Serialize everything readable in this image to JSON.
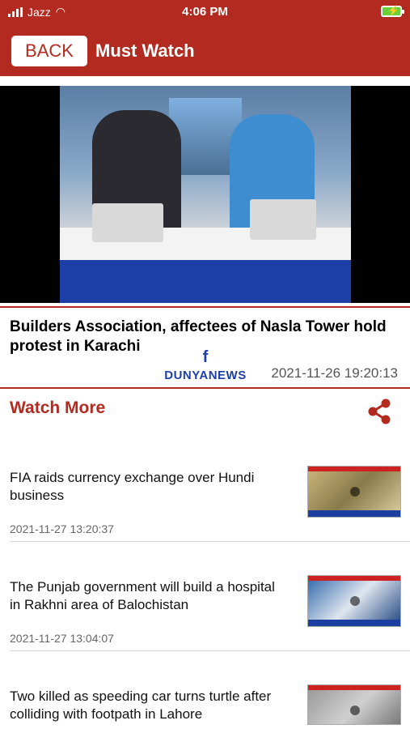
{
  "status": {
    "carrier": "Jazz",
    "time": "4:06 PM"
  },
  "nav": {
    "back_label": "BACK",
    "title": "Must Watch"
  },
  "video": {
    "brand": "DUNYANEWS",
    "fb_glyph": "f"
  },
  "featured": {
    "title": "Builders Association, affectees of Nasla Tower hold protest in Karachi",
    "date": "2021-11-26 19:20:13"
  },
  "watch_more": {
    "title": "Watch More"
  },
  "items": [
    {
      "title": "FIA raids currency exchange over Hundi business",
      "date": "2021-11-27 13:20:37"
    },
    {
      "title": "The Punjab government will build a hospital in Rakhni area of Balochistan",
      "date": "2021-11-27 13:04:07"
    },
    {
      "title": "Two killed as speeding car turns turtle after colliding with footpath in Lahore",
      "date": ""
    }
  ],
  "colors": {
    "brand_red": "#b22a20",
    "brand_blue": "#1d3fa8"
  }
}
